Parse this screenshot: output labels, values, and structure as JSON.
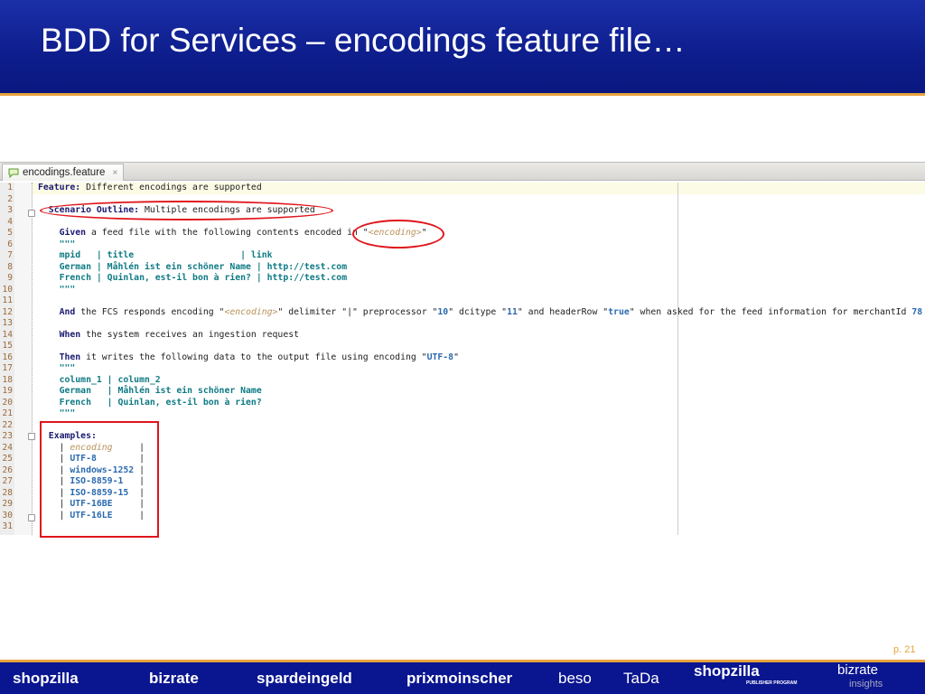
{
  "slide": {
    "title": "BDD for Services – encodings feature file…",
    "page": "p. 21"
  },
  "editor": {
    "tab_label": "encodings.feature",
    "tab_close": "×",
    "lines": [
      [
        {
          "t": "Feature:",
          "c": "k"
        },
        {
          "t": " Different encodings are supported"
        }
      ],
      [],
      [
        {
          "t": "  "
        },
        {
          "t": "Scenario Outline:",
          "c": "k"
        },
        {
          "t": " Multiple encodings are supported"
        }
      ],
      [],
      [
        {
          "t": "    "
        },
        {
          "t": "Given",
          "c": "k"
        },
        {
          "t": " a feed file with the following contents encoded in \""
        },
        {
          "t": "<encoding>",
          "c": "p"
        },
        {
          "t": "\""
        }
      ],
      [
        {
          "t": "    \"\"\"",
          "c": "t"
        }
      ],
      [
        {
          "t": "    mpid   | title                    | link",
          "c": "t"
        }
      ],
      [
        {
          "t": "    German | Måhlén ist ein schöner Name | http://test.com",
          "c": "t"
        }
      ],
      [
        {
          "t": "    French | Quinlan, est-il bon à rien? | http://test.com",
          "c": "t"
        }
      ],
      [
        {
          "t": "    \"\"\"",
          "c": "t"
        }
      ],
      [],
      [
        {
          "t": "    "
        },
        {
          "t": "And",
          "c": "k"
        },
        {
          "t": " the FCS responds encoding \""
        },
        {
          "t": "<encoding>",
          "c": "p"
        },
        {
          "t": "\" delimiter \"|\" preprocessor \""
        },
        {
          "t": "10",
          "c": "s"
        },
        {
          "t": "\" dcitype \""
        },
        {
          "t": "11",
          "c": "s"
        },
        {
          "t": "\" and headerRow \""
        },
        {
          "t": "true",
          "c": "s"
        },
        {
          "t": "\" when asked for the feed information for merchantId "
        },
        {
          "t": "78",
          "c": "s"
        }
      ],
      [],
      [
        {
          "t": "    "
        },
        {
          "t": "When",
          "c": "k"
        },
        {
          "t": " the system receives an ingestion request"
        }
      ],
      [],
      [
        {
          "t": "    "
        },
        {
          "t": "Then",
          "c": "k"
        },
        {
          "t": " it writes the following data to the output file using encoding \""
        },
        {
          "t": "UTF-8",
          "c": "s"
        },
        {
          "t": "\""
        }
      ],
      [
        {
          "t": "    \"\"\"",
          "c": "t"
        }
      ],
      [
        {
          "t": "    column_1 | column_2",
          "c": "t"
        }
      ],
      [
        {
          "t": "    German   | Måhlén ist ein schöner Name",
          "c": "t"
        }
      ],
      [
        {
          "t": "    French   | Quinlan, est-il bon à rien?",
          "c": "t"
        }
      ],
      [
        {
          "t": "    \"\"\"",
          "c": "t"
        }
      ],
      [],
      [
        {
          "t": "  "
        },
        {
          "t": "Examples:",
          "c": "k"
        }
      ],
      [
        {
          "t": "    | "
        },
        {
          "t": "encoding",
          "c": "p"
        },
        {
          "t": "     |"
        }
      ],
      [
        {
          "t": "    | "
        },
        {
          "t": "UTF-8",
          "c": "s"
        },
        {
          "t": "        |"
        }
      ],
      [
        {
          "t": "    | "
        },
        {
          "t": "windows-1252",
          "c": "s"
        },
        {
          "t": " |"
        }
      ],
      [
        {
          "t": "    | "
        },
        {
          "t": "ISO-8859-1",
          "c": "s"
        },
        {
          "t": "   |"
        }
      ],
      [
        {
          "t": "    | "
        },
        {
          "t": "ISO-8859-15",
          "c": "s"
        },
        {
          "t": "  |"
        }
      ],
      [
        {
          "t": "    | "
        },
        {
          "t": "UTF-16BE",
          "c": "s"
        },
        {
          "t": "     |"
        }
      ],
      [
        {
          "t": "    | "
        },
        {
          "t": "UTF-16LE",
          "c": "s"
        },
        {
          "t": "     |"
        }
      ],
      []
    ]
  },
  "footer": {
    "logos": [
      "shopzilla",
      "bizrate",
      "spardeingeld",
      "prixmoinscher",
      "beso",
      "TaDa",
      "shopzilla",
      "bizrate"
    ],
    "sublabels": [
      "PUBLISHER PROGRAM",
      "insights"
    ]
  },
  "colors": {
    "accent": "#e8a33c",
    "header": "#0d1d8c",
    "highlight": "#e0141b"
  }
}
